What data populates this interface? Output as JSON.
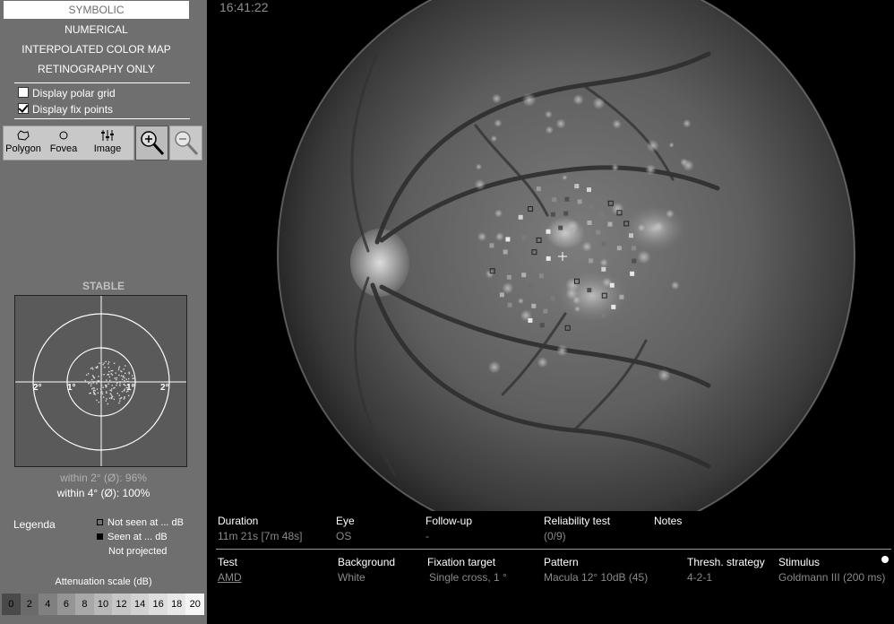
{
  "sidebar": {
    "modes": [
      "SYMBOLIC",
      "NUMERICAL",
      "INTERPOLATED COLOR MAP",
      "RETINOGRAPHY ONLY"
    ],
    "active_mode": "SYMBOLIC",
    "checkboxes": [
      {
        "label": "Display polar grid",
        "checked": false
      },
      {
        "label": "Display fix points",
        "checked": true
      }
    ],
    "tools": [
      {
        "label": "Polygon",
        "icon": "polygon-icon"
      },
      {
        "label": "Fovea",
        "icon": "circle-icon"
      },
      {
        "label": "Image",
        "icon": "sliders-icon"
      }
    ],
    "zoom_buttons": [
      {
        "icon": "zoom-in-icon",
        "pressed": true
      },
      {
        "icon": "zoom-out-icon",
        "pressed": false
      }
    ]
  },
  "fixation": {
    "stability": "STABLE",
    "ring_labels": {
      "inner_left": "1°",
      "inner_right": "1°",
      "outer_left": "2°",
      "outer_right": "2°"
    },
    "within2": "within 2° (Ø): 96%",
    "within4": "within 4° (Ø): 100%"
  },
  "legend": {
    "title": "Legenda",
    "items": [
      "Not seen at ... dB",
      "Seen at ... dB",
      "Not projected"
    ]
  },
  "attenuation": {
    "title": "Attenuation scale (dB)",
    "values": [
      "0",
      "2",
      "4",
      "6",
      "8",
      "10",
      "12",
      "14",
      "16",
      "18",
      "20"
    ],
    "colors": [
      "#4a4a4a",
      "#6a6a6a",
      "#808080",
      "#959595",
      "#a8a8a8",
      "#b8b8b8",
      "#c6c6c6",
      "#d2d2d2",
      "#dedede",
      "#e8e8e8",
      "#f5f5f5"
    ]
  },
  "timestamp": "16:41:22",
  "info": {
    "duration_label": "Duration",
    "duration_value": "11m 21s [7m 48s]",
    "eye_label": "Eye",
    "eye_value": "OS",
    "followup_label": "Follow-up",
    "followup_value": "-",
    "reliability_label": "Reliability test",
    "reliability_value": "(0/9)",
    "notes_label": "Notes",
    "test_label": "Test",
    "test_value": "AMD",
    "background_label": "Background",
    "background_value": "White",
    "fixation_label": "Fixation target",
    "fixation_value": "Single cross, 1 °",
    "pattern_label": "Pattern",
    "pattern_value": "Macula 12° 10dB (45)",
    "strategy_label": "Thresh. strategy",
    "strategy_value": "4-2-1",
    "stimulus_label": "Stimulus",
    "stimulus_value": "Goldmann III (200 ms)"
  },
  "colors": {
    "sidebar_bg": "#6f6f6f",
    "panel_bg": "#000000",
    "label": "#ffffff",
    "value": "#8a8a8a"
  }
}
